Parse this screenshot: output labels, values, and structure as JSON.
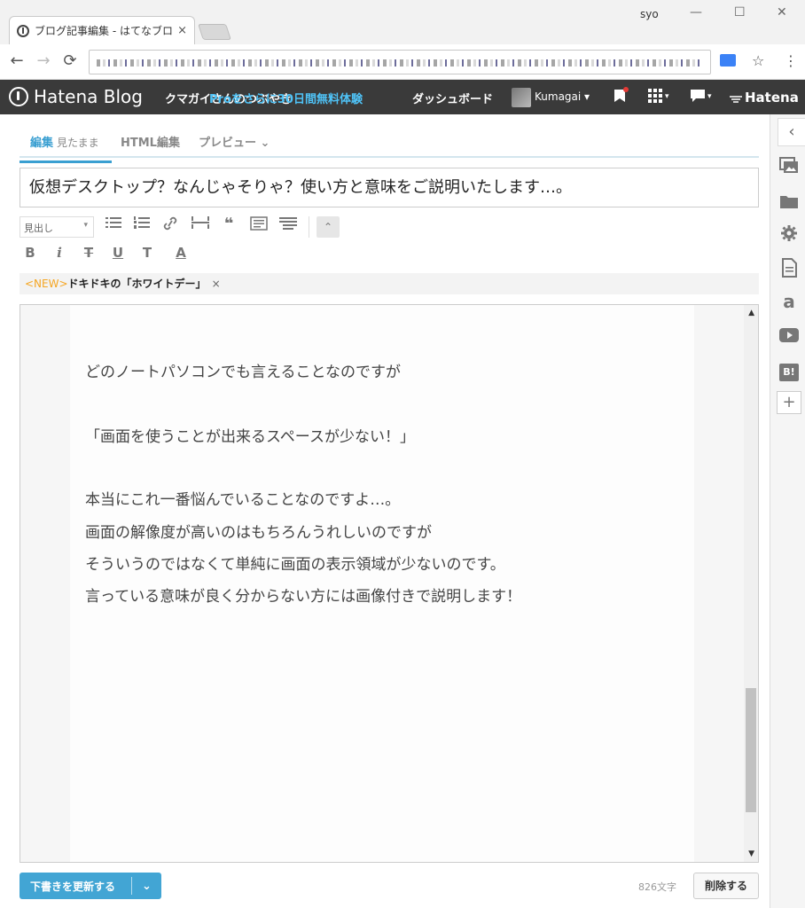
{
  "browser": {
    "tab_title": "ブログ記事編集 - はてなブロ",
    "tab_close": "×",
    "user": "syo",
    "controls": {
      "minimize": "—",
      "maximize": "☐",
      "close": "✕"
    },
    "nav": {
      "back": "←",
      "forward": "→",
      "reload": "⟳"
    },
    "bookmark_star": "☆",
    "menu": "⋮"
  },
  "header": {
    "logo_text": "Hatena Blog",
    "blog_name": "クマガイさんのつぶやき",
    "trial_banner": "Proをさらに30日間無料体験",
    "dashboard": "ダッシュボード",
    "user_name": "Kumagai ▾",
    "grid_label": "▾",
    "comment_label": "▾",
    "brand": "Hatena"
  },
  "editor_tabs": {
    "edit": "編集",
    "edit_sub": "見たまま",
    "html": "HTML編集",
    "preview": "プレビュー",
    "preview_caret": "⌄"
  },
  "title_value": "仮想デスクトップ？なんじゃそりゃ？使い方と意味をご説明いたします…。",
  "toolbar": {
    "heading_select": "見出し",
    "icons": [
      "list-bullet-icon",
      "list-number-icon",
      "link-icon",
      "more-icon",
      "quote-icon",
      "footnote-icon",
      "table-of-contents-icon"
    ],
    "format": {
      "bold": "B",
      "italic": "i",
      "strike": "T",
      "underline": "U",
      "size": "T",
      "color": "A"
    },
    "collapse": "⌃"
  },
  "notice": {
    "new_tag": "<NEW>",
    "text": "ドキドキの「ホワイトデー」",
    "close": "×"
  },
  "body_lines": [
    "どのノートパソコンでも言えることなのですが",
    "「画面を使うことが出来るスペースが少ない！」",
    "本当にこれ一番悩んでいることなのですよ…。",
    "画面の解像度が高いのはもちろんうれしいのですが",
    "そういうのではなくて単純に画面の表示領域が少ないのです。",
    "言っている意味が良く分からない方には画像付きで説明します！"
  ],
  "footer": {
    "save_label": "下書きを更新する",
    "save_caret": "⌄",
    "char_count": "826文字",
    "delete_label": "削除する"
  },
  "sidebar": {
    "toggle": "‹",
    "amazon": "a",
    "hatebu": "B!",
    "add": "+"
  },
  "colors": {
    "accent": "#3a9fd1",
    "header_bg": "#3a3a3a",
    "trial": "#4fc3f7",
    "new_tag": "#f5a623"
  }
}
